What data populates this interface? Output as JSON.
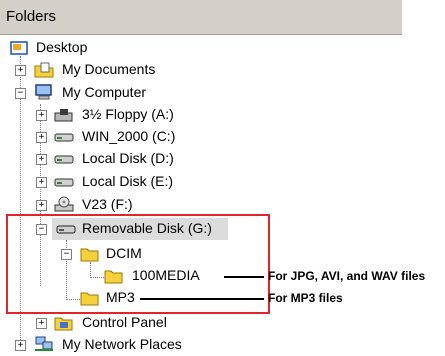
{
  "header": {
    "title": "Folders"
  },
  "tree": {
    "desktop": "Desktop",
    "my_documents": "My Documents",
    "my_computer": "My Computer",
    "floppy": "3½ Floppy (A:)",
    "win2000": "WIN_2000 (C:)",
    "local_d": "Local Disk (D:)",
    "local_e": "Local Disk (E:)",
    "v23": "V23 (F:)",
    "removable": "Removable Disk (G:)",
    "dcim": "DCIM",
    "media100": "100MEDIA",
    "mp3": "MP3",
    "control_panel": "Control Panel",
    "network": "My Network Places"
  },
  "expanders": {
    "plus": "+",
    "minus": "−"
  },
  "callouts": {
    "media": "For JPG, AVI, and WAV files",
    "mp3": "For MP3 files"
  },
  "colors": {
    "highlight_box": "#e0262b",
    "folder_yellow": "#f5d23c"
  }
}
